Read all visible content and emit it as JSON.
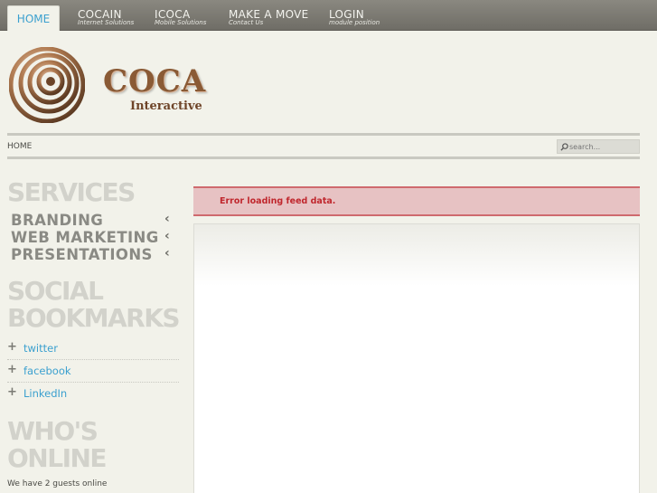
{
  "nav": {
    "home": "HOME",
    "items": [
      {
        "title": "COCAIN",
        "subtitle": "Internet Solutions"
      },
      {
        "title": "ICOCA",
        "subtitle": "Mobile Solutions"
      },
      {
        "title": "MAKE A MOVE",
        "subtitle": "Contact Us"
      },
      {
        "title": "LOGIN",
        "subtitle": "module position"
      }
    ]
  },
  "logo": {
    "name": "COCA",
    "tagline": "Interactive"
  },
  "breadcrumb": "HOME",
  "search": {
    "placeholder": "search..."
  },
  "services": {
    "heading": "SERVICES",
    "items": [
      "BRANDING",
      "WEB MARKETING",
      "PRESENTATIONS"
    ]
  },
  "bookmarks": {
    "heading_line1": "SOCIAL",
    "heading_line2": "BOOKMARKS",
    "items": [
      "twitter",
      "facebook",
      "LinkedIn"
    ]
  },
  "online": {
    "heading_line1": "WHO'S",
    "heading_line2": "ONLINE",
    "text": "We have 2 guests online"
  },
  "error": "Error loading feed data.",
  "colors": {
    "link": "#3ba0cf",
    "error_text": "#c0272d",
    "error_bg": "#e7c2c3",
    "brand": "#8a5a35"
  }
}
